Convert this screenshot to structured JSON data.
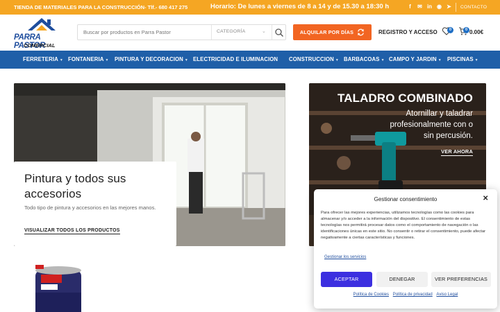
{
  "topbar": {
    "store_text": "TIENDA DE MATERIALES PARA LA CONSTRUCCIÓN- Tlf.- 680 417 275",
    "hours": "Horario: De lunes a viernes de 8 a 14 y de 15.30 a 18:30 h",
    "social_icons": [
      "facebook-icon",
      "email-icon",
      "linkedin-icon",
      "whatsapp-icon",
      "telegram-icon"
    ],
    "contact_label": "CONTACTO"
  },
  "header": {
    "logo_name": "PARRA PASTOR",
    "logo_sub": "COMERCIAL",
    "search_placeholder": "Buscar por productos en Parra Pastor",
    "category_label": "CATEGORÍA",
    "rent_button": "ALQUILAR POR DÍAS",
    "login_label": "REGISTRO Y ACCESO",
    "wishlist_count": "0",
    "cart_count": "0",
    "cart_total": "0.00€"
  },
  "nav": {
    "items": [
      "FERRETERIA",
      "FONTANERIA",
      "PINTURA Y DECORACION",
      "ELECTRICIDAD E ILUMINACION",
      "CONSTRUCCION",
      "BARBACOAS",
      "CAMPO Y JARDIN",
      "PISCINAS"
    ]
  },
  "hero_paint": {
    "title": "Pintura y todos sus accesorios",
    "description": "Todo tipo de pintura y accesorios en las mejores manos.",
    "link": "VISUALIZAR TODOS LOS PRODUCTOS"
  },
  "hero_drill": {
    "title": "TALADRO COMBINADO",
    "subtitle": "Atornillar y taladrar profesionalmente con o sin percusión.",
    "link": "VER AHORA"
  },
  "consent": {
    "title": "Gestionar consentimiento",
    "body": "Para ofrecer las mejores experiencias, utilizamos tecnologías como las cookies para almacenar y/o acceder a la información del dispositivo. El consentimiento de estas tecnologías nos permitirá procesar datos como el comportamiento de navegación o las identificaciones únicas en este sitio. No consentir o retirar el consentimiento, puede afectar negativamente a ciertas características y funciones.",
    "manage_services": "Gestionar los servicios",
    "accept": "ACEPTAR",
    "deny": "DENEGAR",
    "preferences": "VER PREFERENCIAS",
    "links": [
      "Política de Cookies",
      "Política de privacidad",
      "Aviso Legal"
    ]
  },
  "colors": {
    "topbar": "#f5a623",
    "nav": "#1f5fa8",
    "rent_button": "#f26522",
    "accept_button": "#3c2fe0",
    "logo_blue": "#1f4e9e"
  }
}
